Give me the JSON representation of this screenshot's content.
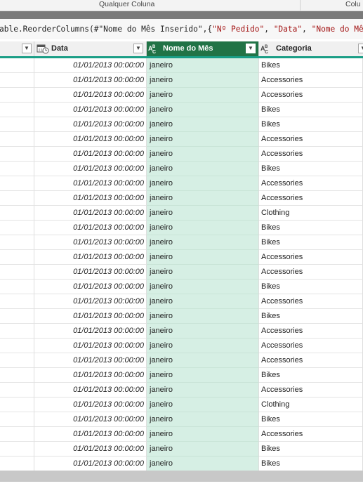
{
  "ribbon": {
    "group1_label": "Qualquer Coluna",
    "group2_label": "Colu"
  },
  "formula": {
    "prefix": "able.ReorderColumns(#\"Nome do Mês Inserido\",{",
    "str1": "\"Nº Pedido\"",
    "sep1": ", ",
    "str2": "\"Data\"",
    "sep2": ", ",
    "str3": "\"Nome do Mês\""
  },
  "columns": [
    {
      "label": "",
      "type_icon": "",
      "selected": false
    },
    {
      "label": "Data",
      "type_icon": "calendar-clock-icon",
      "selected": false
    },
    {
      "label": "Nome do Mês",
      "type_icon": "abc-text-type-icon",
      "selected": true
    },
    {
      "label": "Categoria",
      "type_icon": "abc-text-type-icon",
      "selected": false
    }
  ],
  "rows": [
    {
      "data": "01/01/2013 00:00:00",
      "mes": "janeiro",
      "categoria": "Bikes"
    },
    {
      "data": "01/01/2013 00:00:00",
      "mes": "janeiro",
      "categoria": "Accessories"
    },
    {
      "data": "01/01/2013 00:00:00",
      "mes": "janeiro",
      "categoria": "Accessories"
    },
    {
      "data": "01/01/2013 00:00:00",
      "mes": "janeiro",
      "categoria": "Bikes"
    },
    {
      "data": "01/01/2013 00:00:00",
      "mes": "janeiro",
      "categoria": "Bikes"
    },
    {
      "data": "01/01/2013 00:00:00",
      "mes": "janeiro",
      "categoria": "Accessories"
    },
    {
      "data": "01/01/2013 00:00:00",
      "mes": "janeiro",
      "categoria": "Accessories"
    },
    {
      "data": "01/01/2013 00:00:00",
      "mes": "janeiro",
      "categoria": "Bikes"
    },
    {
      "data": "01/01/2013 00:00:00",
      "mes": "janeiro",
      "categoria": "Accessories"
    },
    {
      "data": "01/01/2013 00:00:00",
      "mes": "janeiro",
      "categoria": "Accessories"
    },
    {
      "data": "01/01/2013 00:00:00",
      "mes": "janeiro",
      "categoria": "Clothing"
    },
    {
      "data": "01/01/2013 00:00:00",
      "mes": "janeiro",
      "categoria": "Bikes"
    },
    {
      "data": "01/01/2013 00:00:00",
      "mes": "janeiro",
      "categoria": "Bikes"
    },
    {
      "data": "01/01/2013 00:00:00",
      "mes": "janeiro",
      "categoria": "Accessories"
    },
    {
      "data": "01/01/2013 00:00:00",
      "mes": "janeiro",
      "categoria": "Accessories"
    },
    {
      "data": "01/01/2013 00:00:00",
      "mes": "janeiro",
      "categoria": "Bikes"
    },
    {
      "data": "01/01/2013 00:00:00",
      "mes": "janeiro",
      "categoria": "Accessories"
    },
    {
      "data": "01/01/2013 00:00:00",
      "mes": "janeiro",
      "categoria": "Bikes"
    },
    {
      "data": "01/01/2013 00:00:00",
      "mes": "janeiro",
      "categoria": "Accessories"
    },
    {
      "data": "01/01/2013 00:00:00",
      "mes": "janeiro",
      "categoria": "Accessories"
    },
    {
      "data": "01/01/2013 00:00:00",
      "mes": "janeiro",
      "categoria": "Accessories"
    },
    {
      "data": "01/01/2013 00:00:00",
      "mes": "janeiro",
      "categoria": "Bikes"
    },
    {
      "data": "01/01/2013 00:00:00",
      "mes": "janeiro",
      "categoria": "Accessories"
    },
    {
      "data": "01/01/2013 00:00:00",
      "mes": "janeiro",
      "categoria": "Clothing"
    },
    {
      "data": "01/01/2013 00:00:00",
      "mes": "janeiro",
      "categoria": "Bikes"
    },
    {
      "data": "01/01/2013 00:00:00",
      "mes": "janeiro",
      "categoria": "Accessories"
    },
    {
      "data": "01/01/2013 00:00:00",
      "mes": "janeiro",
      "categoria": "Bikes"
    },
    {
      "data": "01/01/2013 00:00:00",
      "mes": "janeiro",
      "categoria": "Bikes"
    }
  ],
  "colors": {
    "selected_header": "#217346",
    "selected_column_fill": "#d6efe4",
    "header_accent": "#1a9e86",
    "formula_string": "#a31515"
  }
}
